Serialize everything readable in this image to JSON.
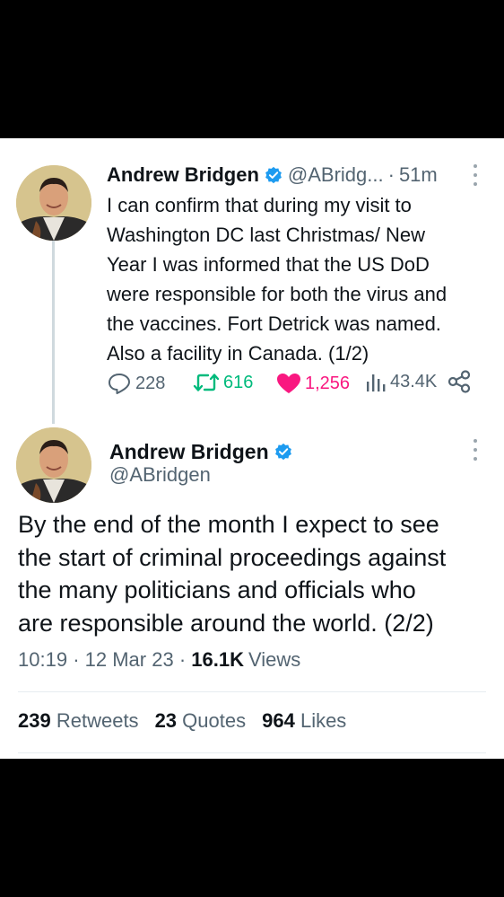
{
  "tweet1": {
    "name": "Andrew Bridgen",
    "handle": "@ABridg...",
    "separator": "·",
    "time": "51m",
    "text_lines": [
      "I can confirm that during my visit to",
      "Washington DC last Christmas/ New",
      "Year I was informed that the US DoD",
      "were responsible for both the virus and",
      "the vaccines. Fort Detrick was named.",
      "Also a facility in Canada. (1/2)"
    ],
    "replies": "228",
    "retweets": "616",
    "likes": "1,256",
    "views": "43.4K"
  },
  "tweet2": {
    "name": "Andrew Bridgen",
    "handle": "@ABridgen",
    "text_lines": [
      "By the end of the month I expect to see",
      "the start of criminal proceedings against",
      "the many politicians and officials who",
      "are responsible around the world. (2/2)"
    ],
    "time": "10:19",
    "date": "12 Mar 23",
    "separator": "·",
    "views_count": "16.1K",
    "views_label": "Views",
    "retweets_count": "239",
    "retweets_label": "Retweets",
    "quotes_count": "23",
    "quotes_label": "Quotes",
    "likes_count": "964",
    "likes_label": "Likes"
  },
  "colors": {
    "verified": "#1d9bf0",
    "retweet": "#00ba7c",
    "like": "#f91880",
    "secondary_text": "#536471"
  },
  "icons": [
    "verified-badge-icon",
    "more-icon",
    "reply-icon",
    "retweet-icon",
    "like-icon",
    "views-icon",
    "share-icon",
    "avatar"
  ]
}
